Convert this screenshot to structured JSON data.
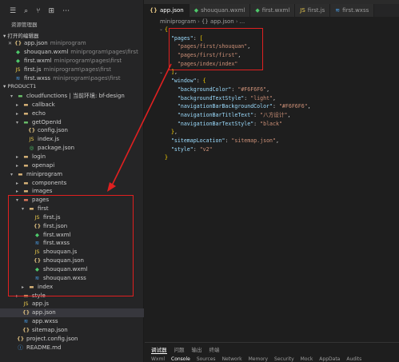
{
  "sidebar": {
    "title": "资源管理器",
    "open_editors_label": "打开的编辑器",
    "open_editors": [
      {
        "icon": "{}",
        "kind": "json",
        "name": "app.json",
        "path": "miniprogram",
        "close": "✕"
      },
      {
        "icon": "◆",
        "kind": "wxml",
        "name": "shouquan.wxml",
        "path": "miniprogram\\pages\\first"
      },
      {
        "icon": "◆",
        "kind": "wxml",
        "name": "first.wxml",
        "path": "miniprogram\\pages\\first"
      },
      {
        "icon": "JS",
        "kind": "js",
        "name": "first.js",
        "path": "miniprogram\\pages\\first"
      },
      {
        "icon": "≋",
        "kind": "wxss",
        "name": "first.wxss",
        "path": "miniprogram\\pages\\first"
      }
    ],
    "project_label": "PRODUCT1",
    "tree": [
      {
        "name": "cloudfunctions | 当前环境: bf-design",
        "kind": "folder-green",
        "depth": 1,
        "open": true
      },
      {
        "name": "callback",
        "kind": "folder",
        "depth": 2,
        "open": false
      },
      {
        "name": "echo",
        "kind": "folder",
        "depth": 2,
        "open": false
      },
      {
        "name": "getOpenId",
        "kind": "folder-green",
        "depth": 2,
        "open": true
      },
      {
        "name": "config.json",
        "kind": "json",
        "depth": 3
      },
      {
        "name": "index.js",
        "kind": "js",
        "depth": 3
      },
      {
        "name": "package.json",
        "kind": "json-g",
        "depth": 3
      },
      {
        "name": "login",
        "kind": "folder",
        "depth": 2,
        "open": false
      },
      {
        "name": "openapi",
        "kind": "folder",
        "depth": 2,
        "open": false
      },
      {
        "name": "miniprogram",
        "kind": "folder",
        "depth": 1,
        "open": true
      },
      {
        "name": "components",
        "kind": "folder",
        "depth": 2,
        "open": false
      },
      {
        "name": "images",
        "kind": "folder",
        "depth": 2,
        "open": false
      },
      {
        "name": "pages",
        "kind": "folder-red",
        "depth": 2,
        "open": true
      },
      {
        "name": "first",
        "kind": "folder",
        "depth": 3,
        "open": true
      },
      {
        "name": "first.js",
        "kind": "js",
        "depth": 4
      },
      {
        "name": "first.json",
        "kind": "json",
        "depth": 4
      },
      {
        "name": "first.wxml",
        "kind": "wxml",
        "depth": 4
      },
      {
        "name": "first.wxss",
        "kind": "wxss",
        "depth": 4
      },
      {
        "name": "shouquan.js",
        "kind": "js",
        "depth": 4
      },
      {
        "name": "shouquan.json",
        "kind": "json",
        "depth": 4
      },
      {
        "name": "shouquan.wxml",
        "kind": "wxml",
        "depth": 4
      },
      {
        "name": "shouquan.wxss",
        "kind": "wxss",
        "depth": 4
      },
      {
        "name": "index",
        "kind": "folder",
        "depth": 3,
        "open": false
      },
      {
        "name": "style",
        "kind": "folder",
        "depth": 2,
        "open": false
      },
      {
        "name": "app.js",
        "kind": "js",
        "depth": 2
      },
      {
        "name": "app.json",
        "kind": "json",
        "depth": 2,
        "selected": true
      },
      {
        "name": "app.wxss",
        "kind": "wxss",
        "depth": 2
      },
      {
        "name": "sitemap.json",
        "kind": "json",
        "depth": 2
      },
      {
        "name": "project.config.json",
        "kind": "json",
        "depth": 1
      },
      {
        "name": "README.md",
        "kind": "md",
        "depth": 1
      }
    ]
  },
  "tabs": [
    {
      "icon": "{}",
      "kind": "json",
      "label": "app.json",
      "active": true
    },
    {
      "icon": "◆",
      "kind": "wxml",
      "label": "shouquan.wxml"
    },
    {
      "icon": "◆",
      "kind": "wxml",
      "label": "first.wxml"
    },
    {
      "icon": "JS",
      "kind": "js",
      "label": "first.js"
    },
    {
      "icon": "≋",
      "kind": "wxss",
      "label": "first.wxss"
    }
  ],
  "breadcrumb": [
    "miniprogram",
    "{} app.json",
    "..."
  ],
  "code_lines": [
    "{",
    "  \"pages\": [",
    "    \"pages/first/shouquan\",",
    "    \"pages/first/first\",",
    "    \"pages/index/index\"",
    "  ],",
    "  \"window\": {",
    "    \"backgroundColor\": \"#F6F6F6\",",
    "    \"backgroundTextStyle\": \"light\",",
    "    \"navigationBarBackgroundColor\": \"#F6F6F6\",",
    "    \"navigationBarTitleText\": \"八方设计\",",
    "    \"navigationBarTextStyle\": \"black\"",
    "  },",
    "  \"sitemapLocation\": \"sitemap.json\",",
    "  \"style\": \"v2\"",
    "}"
  ],
  "panel": {
    "tabs": [
      "调试器",
      "问题",
      "输出",
      "终端"
    ],
    "devtools": [
      "Wxml",
      "Console",
      "Sources",
      "Network",
      "Memory",
      "Security",
      "Mock",
      "AppData",
      "Audits"
    ]
  },
  "colors": {
    "highlight": "#e02020",
    "editor_bg": "#1e1e1e",
    "sidebar_bg": "#252526"
  }
}
